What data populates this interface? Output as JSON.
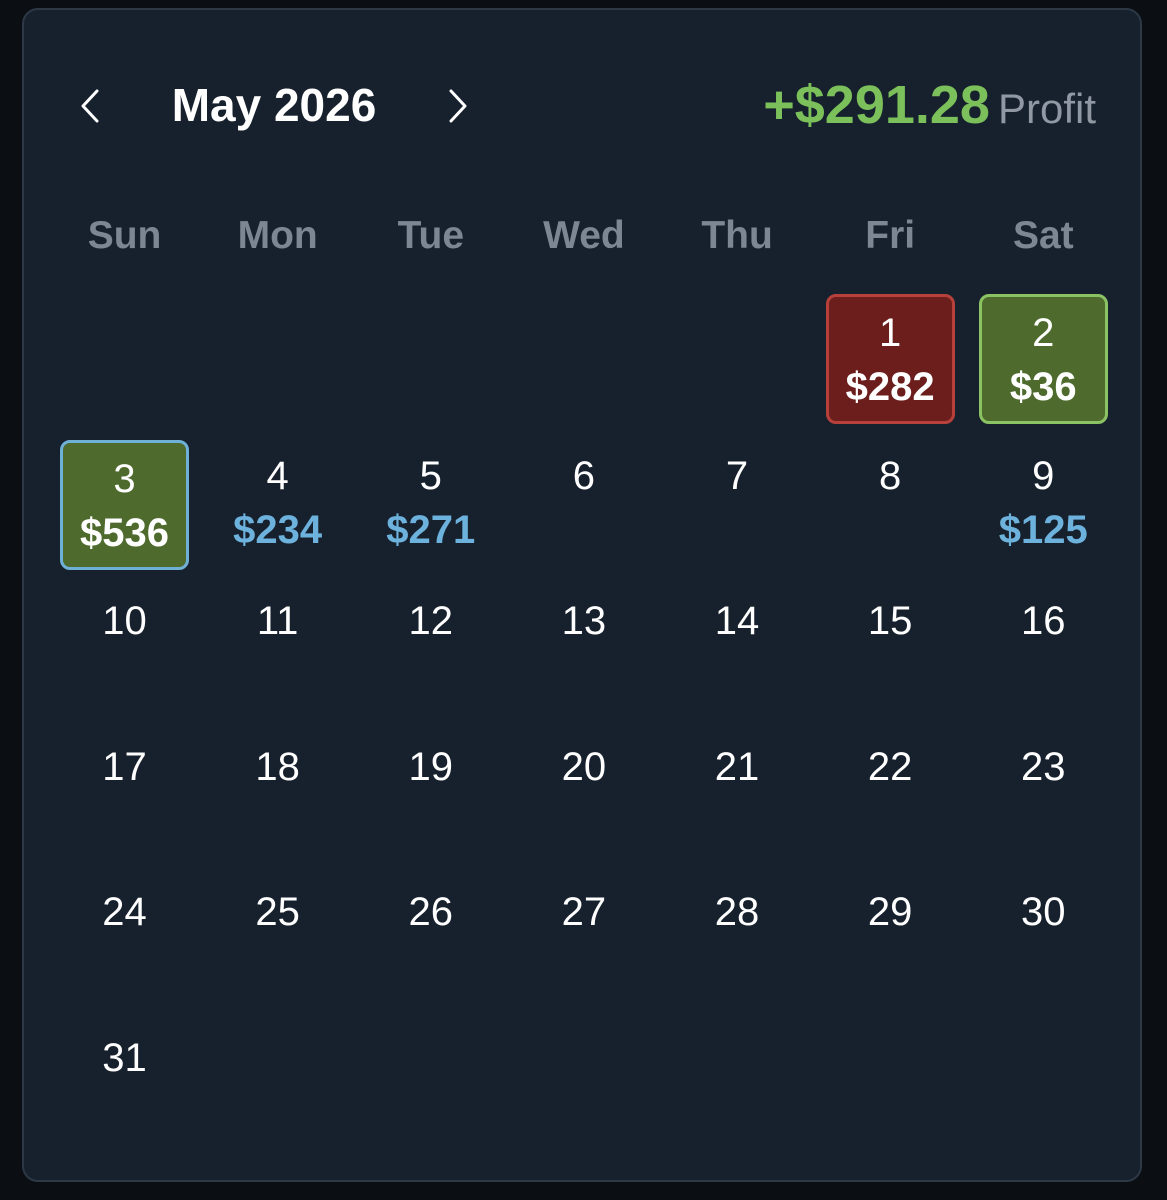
{
  "header": {
    "month_label": "May 2026",
    "prev_label": "previous month",
    "next_label": "next month",
    "profit_amount": "+$291.28",
    "profit_label": "Profit"
  },
  "weekdays": [
    "Sun",
    "Mon",
    "Tue",
    "Wed",
    "Thu",
    "Fri",
    "Sat"
  ],
  "first_weekday_index": 5,
  "days": [
    {
      "day": "1",
      "amount": "$282",
      "status": "loss"
    },
    {
      "day": "2",
      "amount": "$36",
      "status": "win"
    },
    {
      "day": "3",
      "amount": "$536",
      "status": "today"
    },
    {
      "day": "4",
      "amount": "$234",
      "status": "plain"
    },
    {
      "day": "5",
      "amount": "$271",
      "status": "plain"
    },
    {
      "day": "6",
      "amount": "",
      "status": "plain"
    },
    {
      "day": "7",
      "amount": "",
      "status": "plain"
    },
    {
      "day": "8",
      "amount": "",
      "status": "plain"
    },
    {
      "day": "9",
      "amount": "$125",
      "status": "plain"
    },
    {
      "day": "10",
      "amount": "",
      "status": "plain"
    },
    {
      "day": "11",
      "amount": "",
      "status": "plain"
    },
    {
      "day": "12",
      "amount": "",
      "status": "plain"
    },
    {
      "day": "13",
      "amount": "",
      "status": "plain"
    },
    {
      "day": "14",
      "amount": "",
      "status": "plain"
    },
    {
      "day": "15",
      "amount": "",
      "status": "plain"
    },
    {
      "day": "16",
      "amount": "",
      "status": "plain"
    },
    {
      "day": "17",
      "amount": "",
      "status": "plain"
    },
    {
      "day": "18",
      "amount": "",
      "status": "plain"
    },
    {
      "day": "19",
      "amount": "",
      "status": "plain"
    },
    {
      "day": "20",
      "amount": "",
      "status": "plain"
    },
    {
      "day": "21",
      "amount": "",
      "status": "plain"
    },
    {
      "day": "22",
      "amount": "",
      "status": "plain"
    },
    {
      "day": "23",
      "amount": "",
      "status": "plain"
    },
    {
      "day": "24",
      "amount": "",
      "status": "plain"
    },
    {
      "day": "25",
      "amount": "",
      "status": "plain"
    },
    {
      "day": "26",
      "amount": "",
      "status": "plain"
    },
    {
      "day": "27",
      "amount": "",
      "status": "plain"
    },
    {
      "day": "28",
      "amount": "",
      "status": "plain"
    },
    {
      "day": "29",
      "amount": "",
      "status": "plain"
    },
    {
      "day": "30",
      "amount": "",
      "status": "plain"
    },
    {
      "day": "31",
      "amount": "",
      "status": "plain"
    }
  ],
  "colors": {
    "background": "#17212d",
    "profit_green": "#7bc05a",
    "win_fill": "#4e6b2d",
    "loss_fill": "#6b1e1c",
    "amount_blue": "#6db1dd",
    "today_border": "#6fb0d6"
  },
  "icons": {
    "prev": "chevron-left-icon",
    "next": "chevron-right-icon"
  }
}
